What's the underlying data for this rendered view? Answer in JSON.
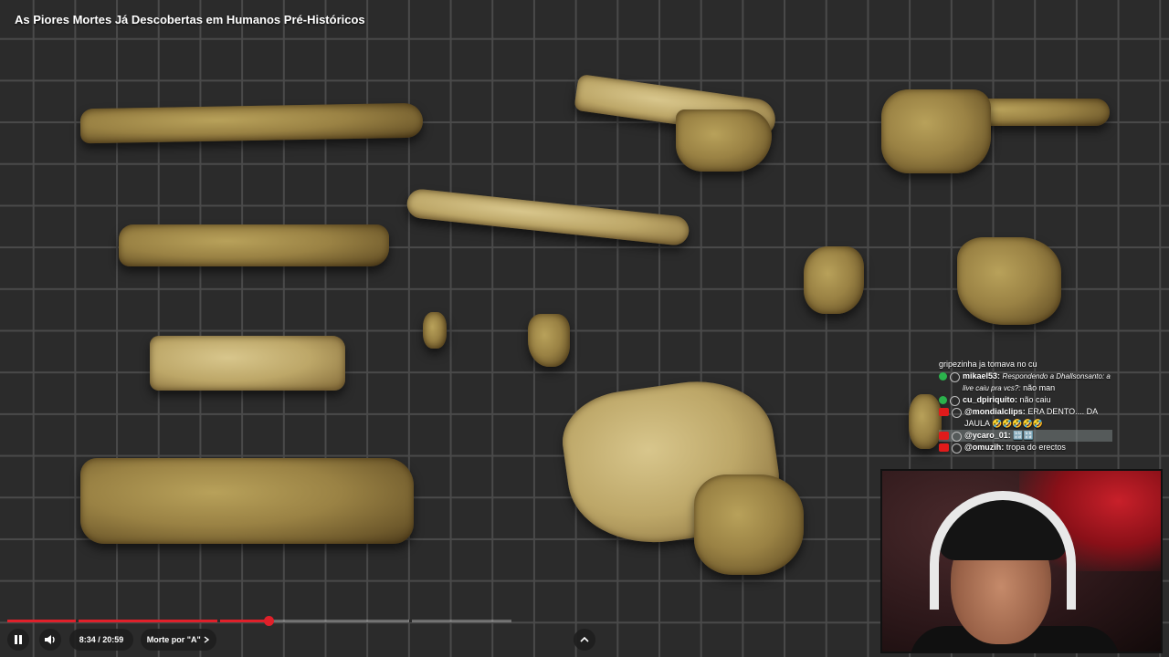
{
  "video": {
    "title": "As Piores Mortes Já Descobertas em Humanos Pré-Históricos"
  },
  "chat": {
    "messages": [
      {
        "user": "",
        "text": "gripezinha ja tomava no cu",
        "badge": "green",
        "highlight": false
      },
      {
        "user": "mikael53:",
        "reply_prefix": "Respondendo a Dhallsonsanto: a live caiu pra vcs?:",
        "text": "não man",
        "badge": "green",
        "highlight": false
      },
      {
        "user": "cu_dpiriquito:",
        "text": "não caiu",
        "badge": "green",
        "highlight": false
      },
      {
        "user": "@mondialclips:",
        "text": "ERA DENTO.... DA JAULA 🤣🤣🤣🤣🤣",
        "badge": "yt",
        "highlight": false
      },
      {
        "user": "@ycaro_01:",
        "text": "🔡🔡",
        "badge": "yt",
        "highlight": true
      },
      {
        "user": "@omuzih:",
        "text": "tropa do erectos",
        "badge": "yt",
        "highlight": false
      }
    ]
  },
  "player": {
    "progress_fraction": 0.409,
    "time_current": "8:34",
    "time_separator": "/",
    "time_total": "20:59",
    "chapter_label": "Morte por \"A\"",
    "colors": {
      "accent": "#e0202a"
    }
  },
  "icons": {
    "pause": "pause-icon",
    "volume": "volume-icon",
    "chevron_right": "chevron-right-icon",
    "chevron_up": "chevron-up-icon"
  }
}
